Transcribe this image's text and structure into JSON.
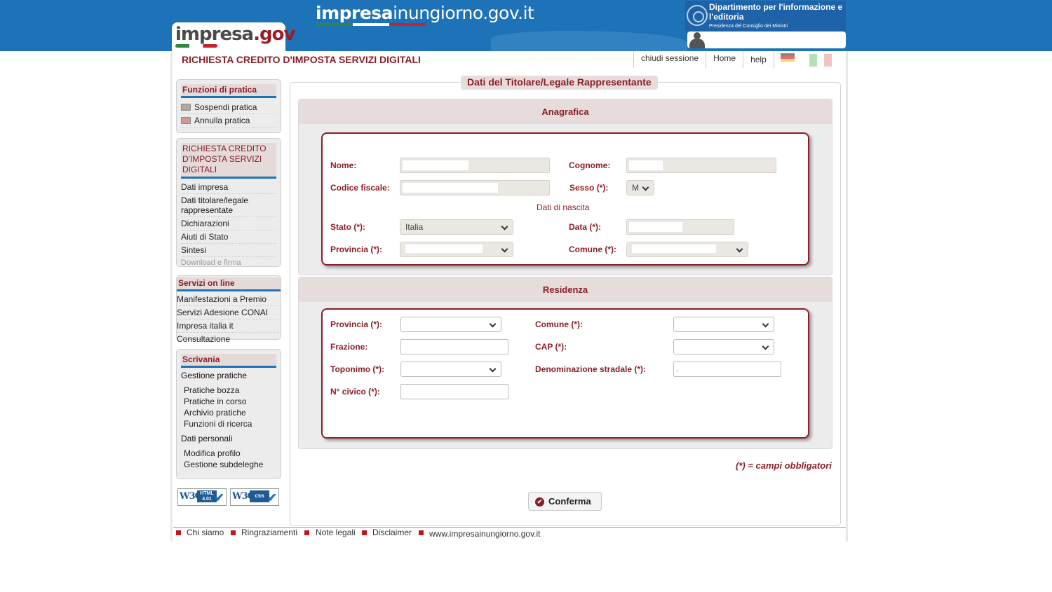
{
  "header": {
    "site_brand_bold": "impresa",
    "site_brand_middle": "inungiorno",
    "site_brand_suffix": ".gov.it",
    "logo_text_a": "impresa",
    "logo_text_b": ".gov",
    "dept_line1": "Dipartimento per l'informazione e l'editoria",
    "dept_line2": "Presidenza del Consiglio dei Ministri",
    "app_title": "RICHIESTA CREDITO D'IMPOSTA SERVIZI DIGITALI",
    "nav": {
      "logout": "chiudi sessione",
      "home": "Home",
      "help": "help"
    }
  },
  "sidebar": {
    "practice_functions": {
      "title": "Funzioni di pratica",
      "items": [
        "Sospendi pratica",
        "Annulla pratica"
      ]
    },
    "request": {
      "title": "RICHIESTA CREDITO D'IMPOSTA SERVIZI DIGITALI",
      "steps": [
        "Dati impresa",
        "Dati titolare/legale rappresentate",
        "Dichiarazioni",
        "Aiuti di Stato",
        "Sintesi",
        "Download e firma"
      ]
    },
    "online_services": {
      "title": "Servizi on line",
      "items": [
        "Manifestazioni a Premio",
        "Servizi Adesione CONAI",
        "Impresa italia it",
        "Consultazione"
      ]
    },
    "desk": {
      "title": "Scrivania",
      "group1": "Gestione pratiche",
      "group1_items": [
        "Pratiche bozza",
        "Pratiche in corso",
        "Archivio pratiche",
        "Funzioni di ricerca"
      ],
      "group2": "Dati personali",
      "group2_items": [
        "Modifica profilo",
        "Gestione subdeleghe"
      ]
    },
    "badges": {
      "html_text": "HTML 4.01",
      "css_text": "css"
    }
  },
  "form": {
    "legend": "Dati del Titolare/Legale Rappresentante",
    "anagrafica": {
      "title": "Anagrafica",
      "nome_label": "Nome:",
      "cognome_label": "Cognome:",
      "codice_fiscale_label": "Codice fiscale:",
      "sesso_label": "Sesso (*):",
      "sesso_value": "M",
      "birth_caption": "Dati di nascita",
      "stato_label": "Stato (*):",
      "stato_value": "Italia",
      "data_label": "Data (*):",
      "provincia_label": "Provincia (*):",
      "comune_label": "Comune (*):"
    },
    "residenza": {
      "title": "Residenza",
      "provincia_label": "Provincia (*):",
      "comune_label": "Comune (*):",
      "frazione_label": "Frazione:",
      "cap_label": "CAP (*):",
      "toponimo_label": "Toponimo (*):",
      "denominazione_label": "Denominazione stradale (*):",
      "denominazione_value": ".",
      "civico_label": "N° civico (*):"
    },
    "required_note": "(*) = campi obbligatori",
    "confirm_label": "Conferma"
  },
  "footer": {
    "links": [
      "Chi siamo",
      "Ringraziamenti",
      "Note legali",
      "Disclaimer"
    ],
    "site": "www.impresainungiorno.gov.it"
  },
  "colors": {
    "header_blue": "#1e73b8",
    "accent_red": "#8b1e27",
    "section_bg": "#ececec",
    "readonly_field": "#ebe7e2",
    "flag_green": "#2d8a3c",
    "flag_red": "#c7232f"
  }
}
